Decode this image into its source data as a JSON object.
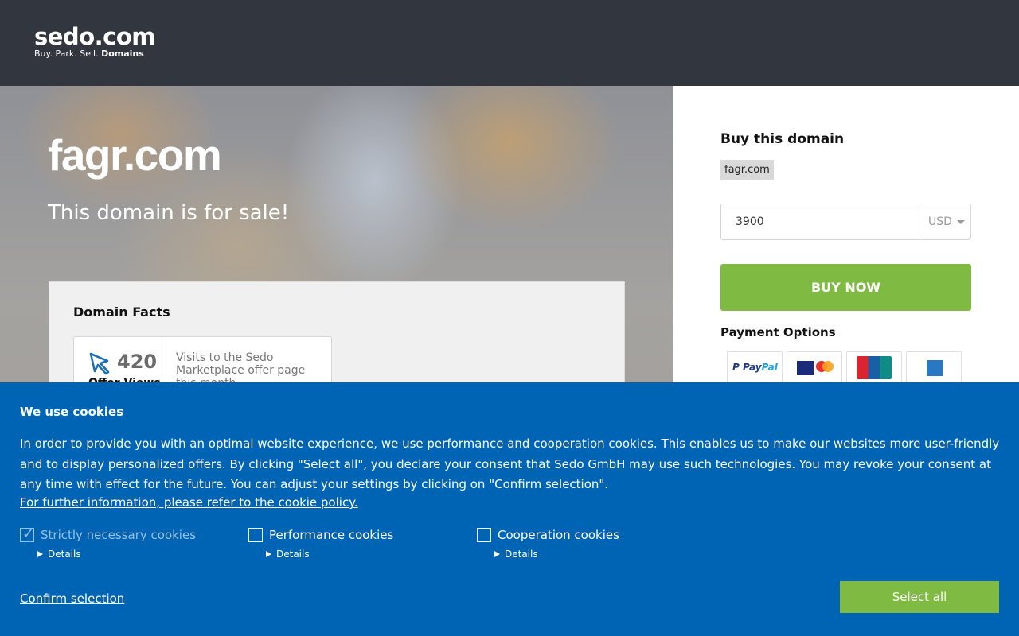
{
  "header": {
    "logo_main": "sedo.com",
    "logo_tagline": "Buy.  Park.  Sell.",
    "logo_tagline_bold": "Domains"
  },
  "hero": {
    "domain": "fagr.com",
    "subtitle": "This domain is for sale!",
    "facts": {
      "title": "Domain Facts",
      "card": {
        "number": "420",
        "label": "Offer Views",
        "description": "Visits to the Sedo Marketplace offer page this month"
      }
    }
  },
  "panel": {
    "title": "Buy this domain",
    "domain_chip": "fagr.com",
    "price": "3900",
    "currency": "USD",
    "buy_button": "BUY NOW",
    "payment_title": "Payment Options",
    "payment_methods": [
      "PayPal",
      "Visa / Mastercard",
      "UnionPay",
      "American Express"
    ]
  },
  "cookies": {
    "title": "We use cookies",
    "body": "In order to provide you with an optimal website experience, we use performance and cooperation cookies. This enables us to make our websites more user-friendly and to display personalized offers. By clicking \"Select all\", you declare your consent that Sedo GmbH may use such technologies. You may revoke your consent at any time with effect for the future. You can adjust your settings by clicking on \"Confirm selection\".",
    "policy_link": "For further information, please refer to the cookie policy.",
    "options": [
      {
        "label": "Strictly necessary cookies",
        "checked": true,
        "details": "Details"
      },
      {
        "label": "Performance cookies",
        "checked": false,
        "details": "Details"
      },
      {
        "label": "Cooperation cookies",
        "checked": false,
        "details": "Details"
      }
    ],
    "confirm": "Confirm selection",
    "select_all": "Select all"
  },
  "colors": {
    "header_bg": "#32363f",
    "accent_green": "#7fbb42",
    "cookie_bg": "#0064b4"
  },
  "icons": [
    "cursor-icon",
    "paypal-icon",
    "visa-mastercard-icon",
    "unionpay-icon",
    "amex-icon",
    "check-icon",
    "triangle-right-icon",
    "caret-down-icon"
  ]
}
